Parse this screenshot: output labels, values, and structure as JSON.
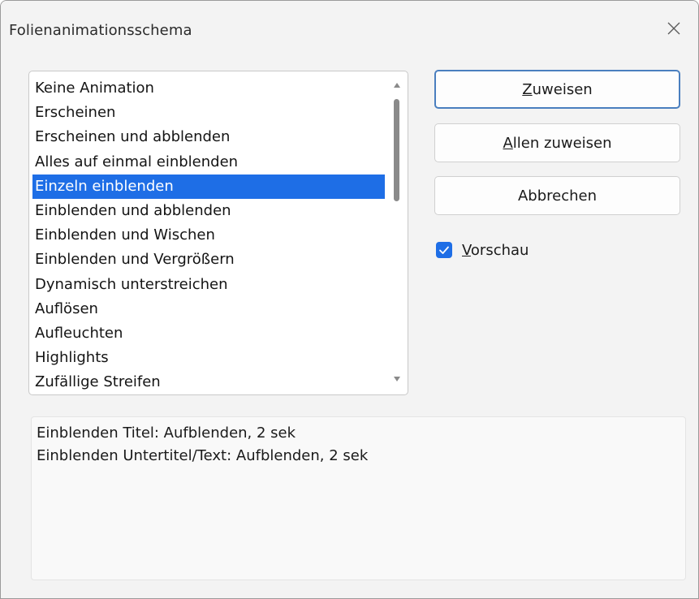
{
  "window": {
    "title": "Folienanimationsschema"
  },
  "list": {
    "items": [
      "Keine Animation",
      "Erscheinen",
      "Erscheinen und abblenden",
      "Alles auf einmal einblenden",
      "Einzeln einblenden",
      "Einblenden und abblenden",
      "Einblenden und Wischen",
      "Einblenden und Vergrößern",
      "Dynamisch unterstreichen",
      "Auflösen",
      "Aufleuchten",
      "Highlights",
      "Zufällige Streifen"
    ],
    "selected_index": 4,
    "scroll_position": 0.0
  },
  "buttons": {
    "assign": {
      "accel": "Z",
      "rest": "uweisen"
    },
    "assign_all": {
      "accel": "A",
      "rest": "llen zuweisen"
    },
    "cancel": {
      "label": "Abbrechen"
    }
  },
  "preview": {
    "checked": true,
    "accel": "V",
    "rest": "orschau"
  },
  "description": {
    "lines": [
      "Einblenden Titel: Aufblenden, 2 sek",
      "Einblenden Untertitel/Text: Aufblenden, 2 sek"
    ]
  },
  "colors": {
    "selection": "#1e6ee6",
    "checkbox": "#1e6ee6",
    "primary_border": "#4a7fbf"
  }
}
